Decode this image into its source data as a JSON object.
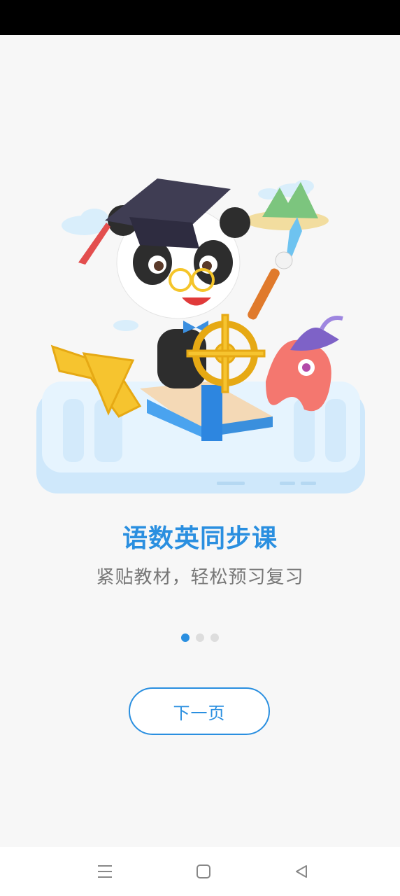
{
  "onboarding": {
    "title": "语数英同步课",
    "subtitle": "紧贴教材，轻松预习复习",
    "pager": {
      "total": 3,
      "active": 0
    },
    "next_label": "下一页"
  },
  "nav": {
    "menu_icon": "menu-icon",
    "home_icon": "home-square-icon",
    "back_icon": "back-triangle-icon"
  },
  "colors": {
    "accent": "#2a8fe0",
    "background": "#f7f7f7"
  }
}
